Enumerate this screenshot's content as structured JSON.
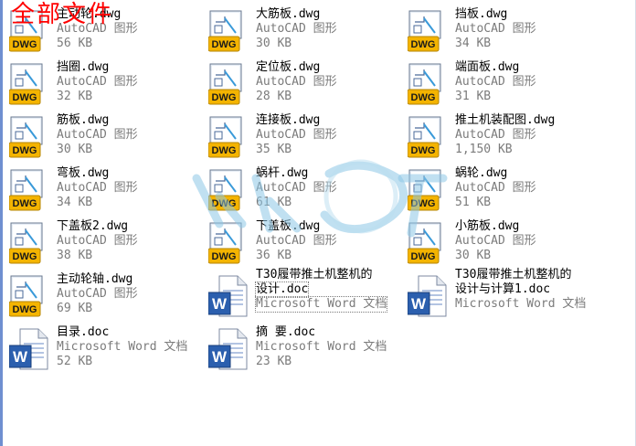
{
  "title": "全部文件",
  "files": [
    {
      "name": "主动轮.dwg",
      "type": "AutoCAD 图形",
      "size": "56 KB",
      "kind": "dwg-icon"
    },
    {
      "name": "大筋板.dwg",
      "type": "AutoCAD 图形",
      "size": "30 KB",
      "kind": "dwg-icon"
    },
    {
      "name": "挡板.dwg",
      "type": "AutoCAD 图形",
      "size": "34 KB",
      "kind": "dwg-icon"
    },
    {
      "name": "挡圈.dwg",
      "type": "AutoCAD 图形",
      "size": "32 KB",
      "kind": "dwg-icon"
    },
    {
      "name": "定位板.dwg",
      "type": "AutoCAD 图形",
      "size": "28 KB",
      "kind": "dwg-icon"
    },
    {
      "name": "端面板.dwg",
      "type": "AutoCAD 图形",
      "size": "31 KB",
      "kind": "dwg-icon"
    },
    {
      "name": "筋板.dwg",
      "type": "AutoCAD 图形",
      "size": "30 KB",
      "kind": "dwg-icon"
    },
    {
      "name": "连接板.dwg",
      "type": "AutoCAD 图形",
      "size": "35 KB",
      "kind": "dwg-icon"
    },
    {
      "name": "推土机装配图.dwg",
      "type": "AutoCAD 图形",
      "size": "1,150 KB",
      "kind": "dwg-icon"
    },
    {
      "name": "弯板.dwg",
      "type": "AutoCAD 图形",
      "size": "34 KB",
      "kind": "dwg-icon"
    },
    {
      "name": "蜗杆.dwg",
      "type": "AutoCAD 图形",
      "size": "61 KB",
      "kind": "dwg-icon"
    },
    {
      "name": "蜗轮.dwg",
      "type": "AutoCAD 图形",
      "size": "51 KB",
      "kind": "dwg-icon"
    },
    {
      "name": "下盖板2.dwg",
      "type": "AutoCAD 图形",
      "size": "38 KB",
      "kind": "dwg-icon"
    },
    {
      "name": "下盖板.dwg",
      "type": "AutoCAD 图形",
      "size": "36 KB",
      "kind": "dwg-icon"
    },
    {
      "name": "小筋板.dwg",
      "type": "AutoCAD 图形",
      "size": "30 KB",
      "kind": "dwg-icon"
    },
    {
      "name": "主动轮轴.dwg",
      "type": "AutoCAD 图形",
      "size": "69 KB",
      "kind": "dwg-icon"
    },
    {
      "name": "T30履带推土机整机的",
      "name2": "设计.doc",
      "type": "Microsoft Word 文档",
      "size": "",
      "kind": "word-icon",
      "selected": true
    },
    {
      "name": "T30履带推土机整机的",
      "name2": "设计与计算1.doc",
      "type": "Microsoft Word 文档",
      "size": "",
      "kind": "word-icon"
    },
    {
      "name": "目录.doc",
      "type": "Microsoft Word 文档",
      "size": "52 KB",
      "kind": "word-icon"
    },
    {
      "name": "摘 要.doc",
      "type": "Microsoft Word 文档",
      "size": "23 KB",
      "kind": "word-icon"
    }
  ],
  "colors": {
    "title": "#ff0000",
    "dwg_badge": "#f4b400",
    "word_blue": "#2b5fae",
    "secondary_text": "#7b7b7b"
  }
}
